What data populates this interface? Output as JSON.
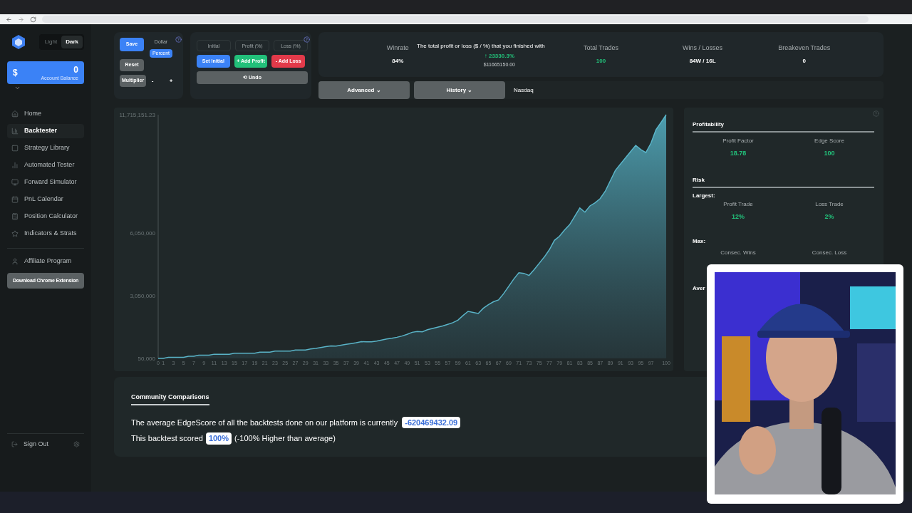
{
  "theme_toggle": [
    {
      "label": "Light",
      "selected": false
    },
    {
      "label": "Dark",
      "selected": true
    }
  ],
  "account": {
    "symbol": "$",
    "value": "0",
    "label": "Account Balance"
  },
  "nav": [
    {
      "label": "Home",
      "selected": false
    },
    {
      "label": "Backtester",
      "selected": true
    },
    {
      "label": "Strategy Library",
      "selected": false
    },
    {
      "label": "Automated Tester",
      "selected": false
    },
    {
      "label": "Forward Simulator",
      "selected": false
    },
    {
      "label": "PnL Calendar",
      "selected": false
    },
    {
      "label": "Position Calculator",
      "selected": false
    },
    {
      "label": "Indicators & Strats",
      "selected": false
    }
  ],
  "affiliate": "Affiliate Program",
  "extension_button": "Download Chrome Extension",
  "sign_out": "Sign Out",
  "controls": {
    "save": "Save",
    "reset": "Reset",
    "mode": [
      {
        "label": "Dollar",
        "selected": false
      },
      {
        "label": "Percent",
        "selected": true
      }
    ],
    "multiplier": "Multiplier",
    "minus": "-",
    "plus": "+"
  },
  "entry": {
    "fields": [
      {
        "placeholder": "Initial"
      },
      {
        "placeholder": "Profit (%)"
      },
      {
        "placeholder": "Loss (%)"
      }
    ],
    "set_initial": "Set Initial",
    "add_profit": "+ Add Profit",
    "add_loss": "- Add Loss",
    "undo": "⟲ Undo"
  },
  "stats": [
    {
      "label": "Winrate",
      "value": "84%",
      "kind": "plain"
    },
    {
      "value": "↑ 23330.3%",
      "sub": "$11665150.00",
      "kind": "pnl"
    },
    {
      "label": "Total Trades",
      "value": "100",
      "kind": "green"
    },
    {
      "label": "Wins / Losses",
      "value": "84W / 16L",
      "kind": "plain"
    },
    {
      "label": "Breakeven Trades",
      "value": "0",
      "kind": "plain"
    }
  ],
  "tooltip": "The total profit or loss ($ / %) that you finished with",
  "filters": {
    "advanced": "Advanced ⌄",
    "history": "History ⌄",
    "market": "Nasdaq"
  },
  "chart_data": {
    "type": "area",
    "ylim": [
      50000,
      11715151.23
    ],
    "xlim": [
      0,
      100
    ],
    "yticks": [
      {
        "value": 50000,
        "label": "50,000"
      },
      {
        "value": 3050000,
        "label": "3,050,000"
      },
      {
        "value": 6050000,
        "label": "6,050,000"
      },
      {
        "value": 11715151.23,
        "label": "11,715,151.23"
      }
    ],
    "xticks": [
      0,
      1,
      3,
      5,
      7,
      9,
      11,
      13,
      15,
      17,
      19,
      21,
      23,
      25,
      27,
      29,
      31,
      33,
      35,
      37,
      39,
      41,
      43,
      45,
      47,
      49,
      51,
      53,
      55,
      57,
      59,
      61,
      63,
      65,
      67,
      69,
      71,
      73,
      75,
      77,
      79,
      81,
      83,
      85,
      87,
      89,
      91,
      93,
      95,
      97,
      100
    ],
    "x": [
      0,
      1,
      2,
      3,
      4,
      5,
      6,
      7,
      8,
      9,
      10,
      11,
      12,
      13,
      14,
      15,
      16,
      17,
      18,
      19,
      20,
      21,
      22,
      23,
      24,
      25,
      26,
      27,
      28,
      29,
      30,
      31,
      32,
      33,
      34,
      35,
      36,
      37,
      38,
      39,
      40,
      41,
      42,
      43,
      44,
      45,
      46,
      47,
      48,
      49,
      50,
      51,
      52,
      53,
      54,
      55,
      56,
      57,
      58,
      59,
      60,
      61,
      62,
      63,
      64,
      65,
      66,
      67,
      68,
      69,
      70,
      71,
      72,
      73,
      74,
      75,
      76,
      77,
      78,
      79,
      80,
      81,
      82,
      83,
      84,
      85,
      86,
      87,
      88,
      89,
      90,
      91,
      92,
      93,
      94,
      95,
      96,
      97,
      98,
      99,
      100
    ],
    "series": [
      {
        "color": "#5ab4c8",
        "values": [
          50000,
          50000,
          100000,
          100000,
          100000,
          100000,
          150000,
          150000,
          200000,
          200000,
          200000,
          250000,
          250000,
          250000,
          250000,
          300000,
          300000,
          300000,
          300000,
          300000,
          350000,
          350000,
          350000,
          400000,
          400000,
          400000,
          400000,
          450000,
          450000,
          450000,
          500000,
          530000,
          570000,
          610000,
          650000,
          640000,
          680000,
          720000,
          760000,
          800000,
          850000,
          840000,
          840000,
          880000,
          930000,
          980000,
          1010000,
          1060000,
          1120000,
          1200000,
          1300000,
          1340000,
          1320000,
          1420000,
          1480000,
          1540000,
          1600000,
          1680000,
          1760000,
          1880000,
          2100000,
          2300000,
          2250000,
          2200000,
          2450000,
          2620000,
          2760000,
          2850000,
          3150000,
          3500000,
          3850000,
          4150000,
          4120000,
          4020000,
          4300000,
          4600000,
          4900000,
          5250000,
          5700000,
          5900000,
          6200000,
          6450000,
          6850000,
          7250000,
          7050000,
          7350000,
          7500000,
          7700000,
          8050000,
          8550000,
          9050000,
          9350000,
          9650000,
          9950000,
          10250000,
          10050000,
          9900000,
          10350000,
          11000000,
          11350000,
          11715151.23
        ]
      }
    ]
  },
  "profitability": {
    "title": "Profitability",
    "items": [
      {
        "label": "Profit Factor",
        "value": "18.78"
      },
      {
        "label": "Edge Score",
        "value": "100"
      }
    ]
  },
  "risk": {
    "title": "Risk",
    "largest": "Largest:",
    "items": [
      {
        "label": "Profit Trade",
        "value": "12%"
      },
      {
        "label": "Loss Trade",
        "value": "2%"
      }
    ],
    "max": "Max:",
    "max_items": [
      {
        "label": "Consec. Wins"
      },
      {
        "label": "Consec. Loss"
      }
    ],
    "average": "Aver"
  },
  "community": {
    "title": "Community Comparisons",
    "line1": "The average EdgeScore of all the backtests done on our platform is currently",
    "avg": "-620469432.09",
    "line2": "This backtest scored",
    "score": "100%",
    "note": "(-100% Higher than average)"
  }
}
